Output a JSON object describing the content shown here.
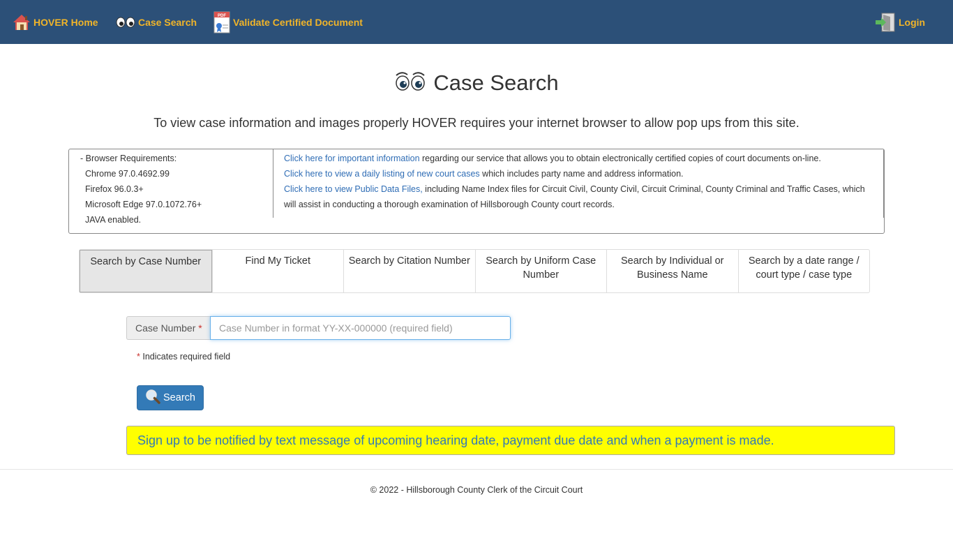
{
  "nav": {
    "home_label": "HOVER Home",
    "search_label": "Case Search",
    "validate_label": "Validate Certified Document",
    "login_label": "Login",
    "pdf_badge": "PDF"
  },
  "header": {
    "title": "Case Search",
    "popup_note": "To view case information and images properly HOVER requires your internet browser to allow pop ups from this site."
  },
  "requirements": {
    "heading": "- Browser Requirements:",
    "items": [
      "Chrome 97.0.4692.99",
      "Firefox 96.0.3+",
      "Microsoft Edge 97.0.1072.76+",
      "JAVA enabled."
    ]
  },
  "info_links": [
    {
      "link": "Click here for important information",
      "text": " regarding our service that allows you to obtain electronically certified copies of court documents on-line."
    },
    {
      "link": "Click here to view a daily listing of new court cases",
      "text": " which includes party name and address information."
    },
    {
      "link": "Click here to view Public Data Files,",
      "text": " including Name Index files for Circuit Civil, County Civil, Circuit Criminal, County Criminal and Traffic Cases, which will assist in conducting a thorough examination of Hillsborough County court records."
    }
  ],
  "tabs": [
    {
      "label": "Search by Case Number",
      "active": true
    },
    {
      "label": "Find My Ticket"
    },
    {
      "label": "Search by Citation Number"
    },
    {
      "label": "Search by Uniform Case Number"
    },
    {
      "label": "Search by Individual or Business Name"
    },
    {
      "label": "Search by a date range / court type / case type"
    }
  ],
  "form": {
    "case_number_label": "Case Number",
    "required_marker": "*",
    "case_number_value": "",
    "case_number_placeholder": "Case Number in format YY-XX-000000 (required field)",
    "required_note": "Indicates required field",
    "search_label": "Search"
  },
  "notify": "Sign up to be notified by text message of upcoming hearing date, payment due date and when a payment is made.",
  "footer": "© 2022 - Hillsborough County Clerk of the Circuit Court",
  "colors": {
    "navbar": "#2c5078",
    "nav_text": "#f0b429",
    "link": "#2f6db5",
    "button": "#337ab7",
    "notify_bg": "#ffff00"
  }
}
